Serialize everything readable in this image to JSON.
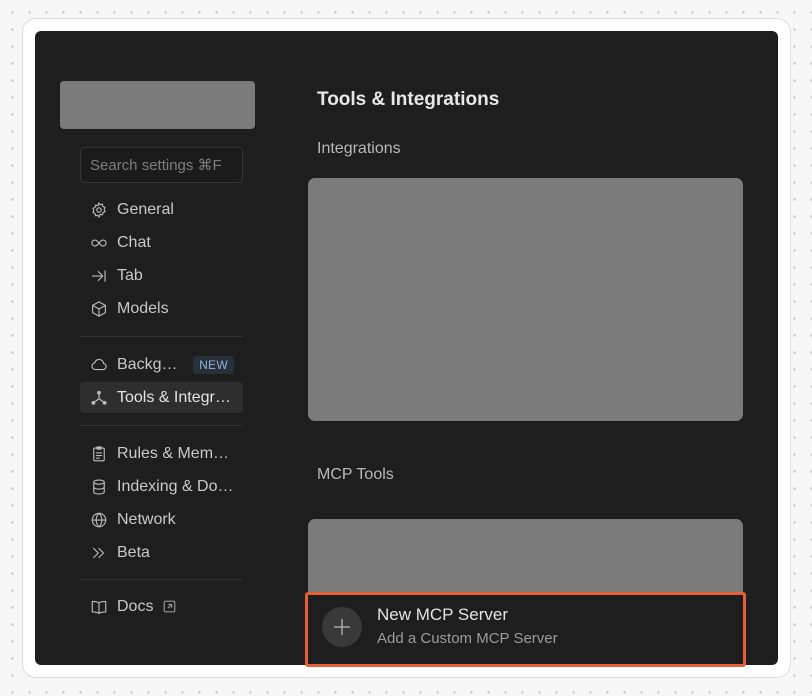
{
  "sidebar": {
    "search_placeholder": "Search settings ⌘F",
    "group1": [
      {
        "label": "General",
        "icon": "gear-icon"
      },
      {
        "label": "Chat",
        "icon": "infinity-icon"
      },
      {
        "label": "Tab",
        "icon": "arrow-right-bar-icon"
      },
      {
        "label": "Models",
        "icon": "cube-icon"
      }
    ],
    "group2": [
      {
        "label": "Backgr…",
        "icon": "cloud-icon",
        "badge": "NEW"
      },
      {
        "label": "Tools & Integr…",
        "icon": "branch-icon",
        "active": true
      }
    ],
    "group3": [
      {
        "label": "Rules & Mem…",
        "icon": "clipboard-icon"
      },
      {
        "label": "Indexing & Do…",
        "icon": "database-icon"
      },
      {
        "label": "Network",
        "icon": "globe-icon"
      },
      {
        "label": "Beta",
        "icon": "double-chevron-icon"
      }
    ],
    "group4": [
      {
        "label": "Docs",
        "icon": "book-icon",
        "external": "external-link-icon"
      }
    ]
  },
  "main": {
    "title": "Tools & Integrations",
    "integrations_label": "Integrations",
    "mcp_tools_label": "MCP Tools",
    "new_mcp": {
      "title": "New MCP Server",
      "subtitle": "Add a Custom MCP Server"
    }
  },
  "colors": {
    "highlight": "#e5603a",
    "window_bg": "#1e1e1e",
    "placeholder": "#7b7b7b"
  }
}
